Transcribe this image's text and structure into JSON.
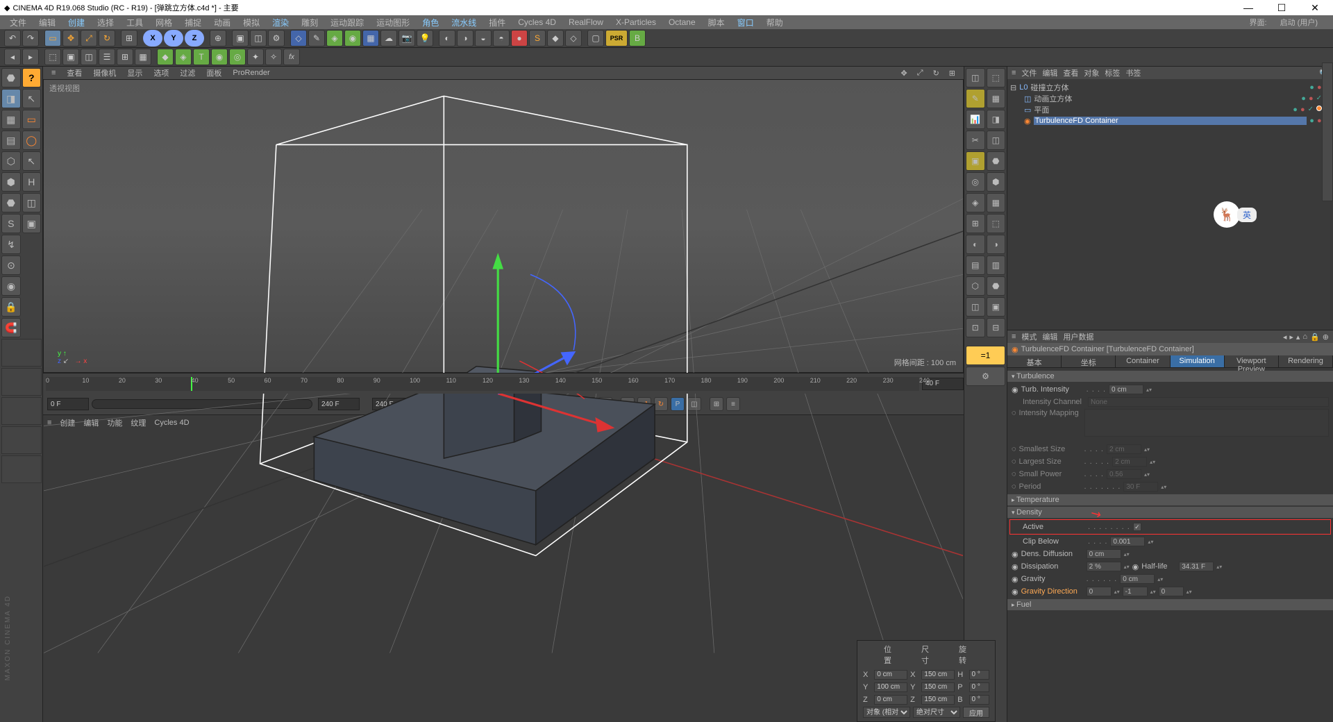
{
  "title": "CINEMA 4D R19.068 Studio (RC - R19) - [弹跳立方体.c4d *] - 主要",
  "menu": [
    "文件",
    "编辑",
    "创建",
    "选择",
    "工具",
    "网格",
    "捕捉",
    "动画",
    "模拟",
    "渲染",
    "雕刻",
    "运动跟踪",
    "运动图形",
    "角色",
    "流水线",
    "插件",
    "Cycles 4D",
    "RealFlow",
    "X-Particles",
    "Octane",
    "脚本",
    "窗口",
    "帮助"
  ],
  "menu_right_label": "界面:",
  "menu_right_value": "启动 (用户)",
  "axes": [
    "X",
    "Y",
    "Z"
  ],
  "psr_label": "PSR",
  "vp_menu": [
    "查看",
    "摄像机",
    "显示",
    "选项",
    "过滤",
    "面板",
    "ProRender"
  ],
  "vp_label": "透视视图",
  "grid_info": "网格间距 : 100 cm",
  "timeline": {
    "start_field": "0 F",
    "end_field": "240 F",
    "current": "40 F",
    "ticks": [
      "0",
      "10",
      "20",
      "30",
      "40",
      "50",
      "60",
      "70",
      "80",
      "90",
      "100",
      "110",
      "120",
      "130",
      "140",
      "150",
      "160",
      "170",
      "180",
      "190",
      "200",
      "210",
      "220",
      "230",
      "240"
    ],
    "marker_at": 40,
    "scroll_start": "0 F"
  },
  "bottom_tabs": [
    "创建",
    "编辑",
    "功能",
    "纹理",
    "Cycles 4D"
  ],
  "obj_menu": [
    "文件",
    "编辑",
    "查看",
    "对象",
    "标签",
    "书签"
  ],
  "objects": [
    {
      "name": "碰撞立方体",
      "indent": 0,
      "icon": "L0"
    },
    {
      "name": "动画立方体",
      "indent": 1,
      "icon": "cube"
    },
    {
      "name": "平面",
      "indent": 1,
      "icon": "plane"
    },
    {
      "name": "TurbulenceFD Container",
      "indent": 1,
      "icon": "tfd",
      "selected": true
    }
  ],
  "attr_menu": [
    "模式",
    "编辑",
    "用户数据"
  ],
  "attr_title": "TurbulenceFD Container [TurbulenceFD Container]",
  "attr_tabs": [
    "基本",
    "坐标",
    "Container",
    "Simulation",
    "Viewport Preview",
    "Rendering"
  ],
  "attr_active_tab": 3,
  "attr": {
    "turbulence": "Turbulence",
    "turb_intensity_lbl": "Turb. Intensity",
    "turb_intensity_val": "0 cm",
    "intensity_channel_lbl": "Intensity Channel",
    "intensity_channel_val": "None",
    "intensity_mapping_lbl": "Intensity Mapping",
    "smallest_lbl": "Smallest Size",
    "smallest_val": "2 cm",
    "largest_lbl": "Largest Size",
    "largest_val": "2 cm",
    "small_power_lbl": "Small Power",
    "small_power_val": "0.56",
    "period_lbl": "Period",
    "period_val": "30 F",
    "temperature": "Temperature",
    "density": "Density",
    "active_lbl": "Active",
    "clip_lbl": "Clip Below",
    "clip_val": "0.001",
    "dens_diff_lbl": "Dens. Diffusion",
    "dens_diff_val": "0 cm",
    "dissipation_lbl": "Dissipation",
    "dissipation_val": "2 %",
    "halflife_lbl": "Half-life",
    "halflife_val": "34.31 F",
    "gravity_lbl": "Gravity",
    "gravity_val": "0 cm",
    "gravity_dir_lbl": "Gravity Direction",
    "gravity_dir_x": "0",
    "gravity_dir_y": "-1",
    "gravity_dir_z": "0",
    "fuel": "Fuel"
  },
  "coord": {
    "headers": [
      "位置",
      "尺寸",
      "旋转"
    ],
    "x_label": "X",
    "y_label": "Y",
    "z_label": "Z",
    "pos_x": "0 cm",
    "pos_y": "100 cm",
    "pos_z": "0 cm",
    "size_x": "150 cm",
    "size_y": "150 cm",
    "size_z": "150 cm",
    "sh": "H",
    "sp": "P",
    "sb": "B",
    "rot_h": "0 °",
    "rot_p": "0 °",
    "rot_b": "0 °",
    "mode1": "对象 (相对)",
    "mode2": "绝对尺寸",
    "apply": "应用"
  },
  "floating_tag": "英",
  "maxon": "MAXON CINEMA 4D"
}
